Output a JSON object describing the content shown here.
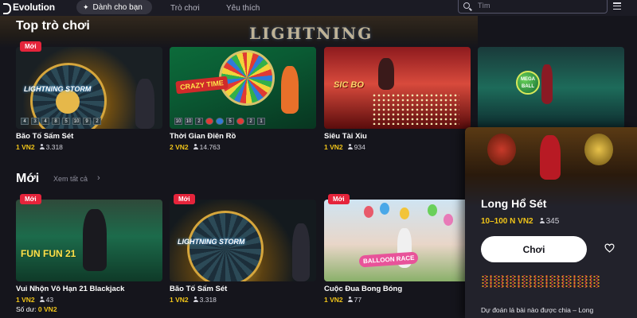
{
  "brand": {
    "name": "Evolution"
  },
  "nav": {
    "tabs": [
      {
        "label": "Dành cho bạn",
        "active": true
      },
      {
        "label": "Trò chơi",
        "active": false
      },
      {
        "label": "Yêu thích",
        "active": false
      }
    ]
  },
  "search": {
    "placeholder": "Tìm",
    "value": ""
  },
  "sections": {
    "top": {
      "title": "Top trò chơi",
      "games": [
        {
          "badge": "Mới",
          "title": "Bão Tố Sấm Sét",
          "price": "1 VN2",
          "players": "3.318"
        },
        {
          "badge": "",
          "title": "Thời Gian Điên Rồ",
          "price": "2 VN2",
          "players": "14.763"
        },
        {
          "badge": "",
          "title": "Siêu Tài Xỉu",
          "price": "1 VN2",
          "players": "934"
        },
        {
          "badge": "",
          "title": "",
          "price": "",
          "players": ""
        }
      ]
    },
    "new": {
      "title": "Mới",
      "see_all": "Xem tất cả",
      "games": [
        {
          "badge": "Mới",
          "title": "Vui Nhộn Vô Hạn 21 Blackjack",
          "price": "1 VN2",
          "players": "43"
        },
        {
          "badge": "Mới",
          "title": "Bão Tố Sấm Sét",
          "price": "1 VN2",
          "players": "3.318"
        },
        {
          "badge": "Mới",
          "title": "Cuộc Đua Bong Bóng",
          "price": "1 VN2",
          "players": "77"
        }
      ]
    }
  },
  "thumb_text": {
    "lightning": "LIGHTNING STORM",
    "crazy": "CRAZY TIME",
    "sicbo": "SIC BO",
    "megaball": "MEGA BALL",
    "fun21": "FUN FUN 21",
    "balloon": "BALLOON RACE",
    "hero": "LIGHTNING"
  },
  "balance": {
    "label": "Số dư:",
    "amount": "0 VN2"
  },
  "detail": {
    "title": "Long Hổ Sét",
    "price": "10–100 N VN2",
    "players": "345",
    "play_label": "Chơi",
    "description": "Dự đoán lá bài nào được chia – Long"
  },
  "colors": {
    "background": "#15151c",
    "accent_gold": "#f0c419",
    "badge_red": "#e5243b",
    "panel": "#22222b"
  },
  "icons": [
    "evolution-logo-icon",
    "sparkle-icon",
    "search-icon",
    "menu-icon",
    "user-icon",
    "chevron-right-icon",
    "heart-icon"
  ]
}
